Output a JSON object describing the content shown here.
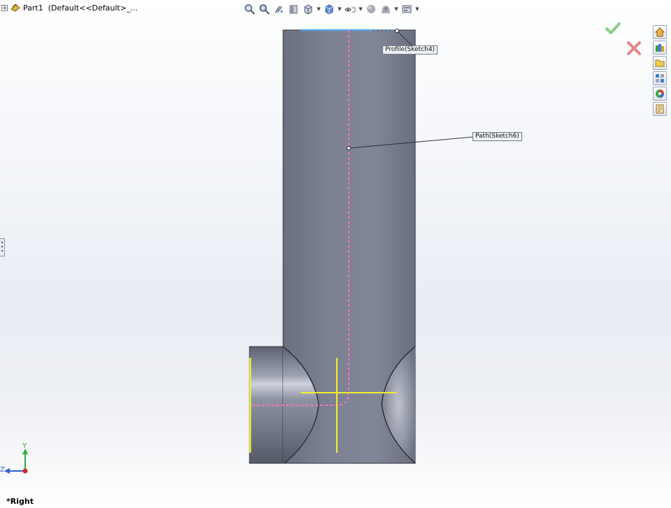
{
  "feature_tree": {
    "expander": "+",
    "root_label": "Part1",
    "config_label": "(Default<<Default>_..."
  },
  "heads_up_toolbar": {
    "tools": [
      {
        "name": "zoom-to-fit-icon",
        "dropdown": false
      },
      {
        "name": "zoom-to-area-icon",
        "dropdown": false
      },
      {
        "name": "previous-view-icon",
        "dropdown": false
      },
      {
        "name": "section-view-icon",
        "dropdown": false
      },
      {
        "name": "view-orientation-icon",
        "dropdown": true
      },
      {
        "name": "display-style-icon",
        "dropdown": true
      },
      {
        "name": "hide-show-items-icon",
        "dropdown": true
      },
      {
        "name": "edit-appearance-icon",
        "dropdown": false
      },
      {
        "name": "apply-scene-icon",
        "dropdown": true
      },
      {
        "name": "view-settings-icon",
        "dropdown": true
      }
    ]
  },
  "confirmation_corner": {
    "ok": "check-icon",
    "cancel": "close-icon",
    "ok_color": "#7cc97c",
    "cancel_color": "#e07a7a"
  },
  "task_pane": [
    "solidworks-resources-icon",
    "design-library-icon",
    "file-explorer-icon",
    "view-palette-icon",
    "appearances-scenes-icon",
    "custom-properties-icon"
  ],
  "callouts": {
    "profile": "Profile(Sketch4)",
    "path": "Path(Sketch6)"
  },
  "triad": {
    "y_label": "Y",
    "z_label": "Z"
  },
  "view_label": "*Right",
  "colors": {
    "body": "#767b8c",
    "path": "#ff6fc8",
    "sketch": "#f2ee2c",
    "profile_edge": "#5aa7e8"
  }
}
